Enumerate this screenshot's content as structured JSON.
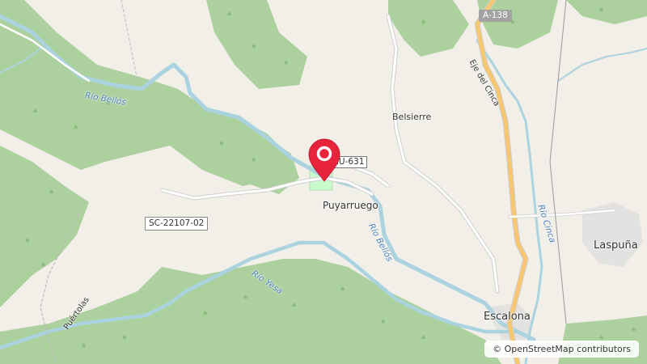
{
  "map": {
    "places": {
      "puyarruego": "Puyarruego",
      "belsierre": "Belsierre",
      "laspuna": "Laspuña",
      "escalona": "Escalona"
    },
    "rivers": {
      "bellos_upper": "Río Bellós",
      "bellos_lower": "Río Bellós",
      "yesa": "Río Yesa",
      "cinca": "Río Cinca"
    },
    "roads": {
      "a138": "A-138",
      "hu631": "HU-631",
      "sc22107": "SC-22107-02",
      "eje_cinca": "Eje del Cinca",
      "puertolas": "Puértolas"
    },
    "attribution": "© OpenStreetMap contributors",
    "marker_icon": "map-pin-icon",
    "colors": {
      "land": "#f2efe9",
      "forest": "#add19e",
      "water": "#aad3df",
      "river_label": "#4a7fb5",
      "marker": "#e8243c",
      "highway": "#f6c671",
      "park": "#c8facc"
    }
  }
}
